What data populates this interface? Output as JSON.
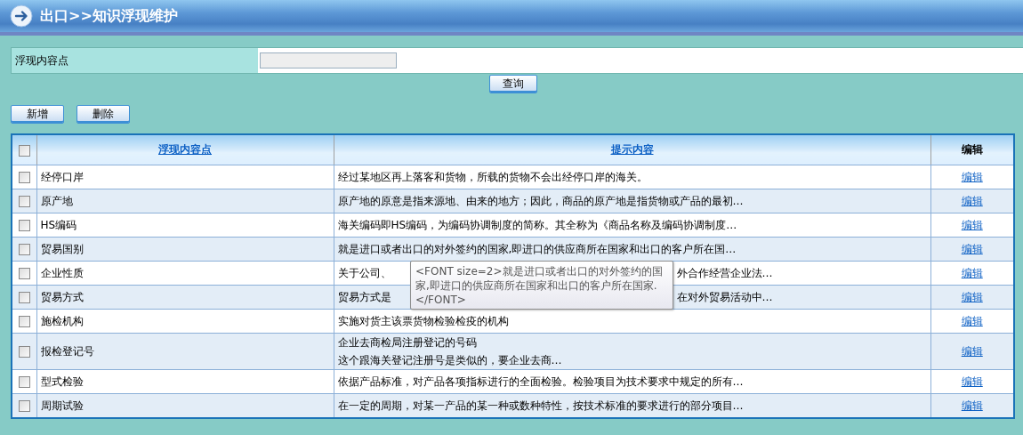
{
  "header": {
    "title": "出口>>知识浮现维护"
  },
  "search": {
    "label": "浮现内容点",
    "query_button": "查询"
  },
  "actions": [
    "新增",
    "删除"
  ],
  "table": {
    "select_all": {
      "checked": false
    },
    "columns": [
      {
        "label": "浮现内容点",
        "kind": "link"
      },
      {
        "label": "提示内容",
        "kind": "link"
      },
      {
        "label": "编辑",
        "kind": "plain"
      }
    ],
    "rows": [
      {
        "checked": false,
        "name": "经停口岸",
        "content": {
          "kind": "lines",
          "lines": [
            "经过某地区再上落客和货物，所载的货物不会出经停口岸的海关。"
          ]
        },
        "edit": "编辑"
      },
      {
        "checked": false,
        "name": "原产地",
        "content": {
          "kind": "lines",
          "lines": [
            "原产地的原意是指来源地、由来的地方；因此，商品的原产地是指货物或产品的最初…"
          ]
        },
        "edit": "编辑"
      },
      {
        "checked": false,
        "name": "HS编码",
        "content": {
          "kind": "lines",
          "lines": [
            "海关编码即HS编码，为编码协调制度的简称。其全称为《商品名称及编码协调制度…"
          ]
        },
        "edit": "编辑"
      },
      {
        "checked": false,
        "name": "贸易国别",
        "content": {
          "kind": "lines",
          "lines": [
            "就是进口或者出口的对外签约的国家,即进口的供应商所在国家和出口的客户所在国…"
          ]
        },
        "edit": "编辑"
      },
      {
        "checked": false,
        "name": "企业性质",
        "content": {
          "kind": "split",
          "before": "关于公司、",
          "after": "外合作经营企业法…"
        },
        "edit": "编辑"
      },
      {
        "checked": false,
        "name": "贸易方式",
        "content": {
          "kind": "split",
          "before": "贸易方式是",
          "after": "在对外贸易活动中…"
        },
        "edit": "编辑"
      },
      {
        "checked": false,
        "name": "施检机构",
        "content": {
          "kind": "lines",
          "lines": [
            "实施对货主该票货物检验检疫的机构"
          ]
        },
        "edit": "编辑"
      },
      {
        "checked": false,
        "name": "报检登记号",
        "content": {
          "kind": "lines",
          "lines": [
            "企业去商检局注册登记的号码",
            "这个跟海关登记注册号是类似的，要企业去商…"
          ]
        },
        "edit": "编辑"
      },
      {
        "checked": false,
        "name": "型式检验",
        "content": {
          "kind": "lines",
          "lines": [
            "依据产品标准，对产品各项指标进行的全面检验。检验项目为技术要求中规定的所有…"
          ]
        },
        "edit": "编辑"
      },
      {
        "checked": false,
        "name": "周期试验",
        "content": {
          "kind": "lines",
          "lines": [
            "在一定的周期，对某一产品的某一种或数种特性，按技术标准的要求进行的部分项目…"
          ]
        },
        "edit": "编辑"
      }
    ]
  },
  "tooltip": {
    "text": "<FONT size=2>就是进口或者出口的对外签约的国家,即进口的供应商所在国家和出口的客户所在国家.</FONT>"
  }
}
